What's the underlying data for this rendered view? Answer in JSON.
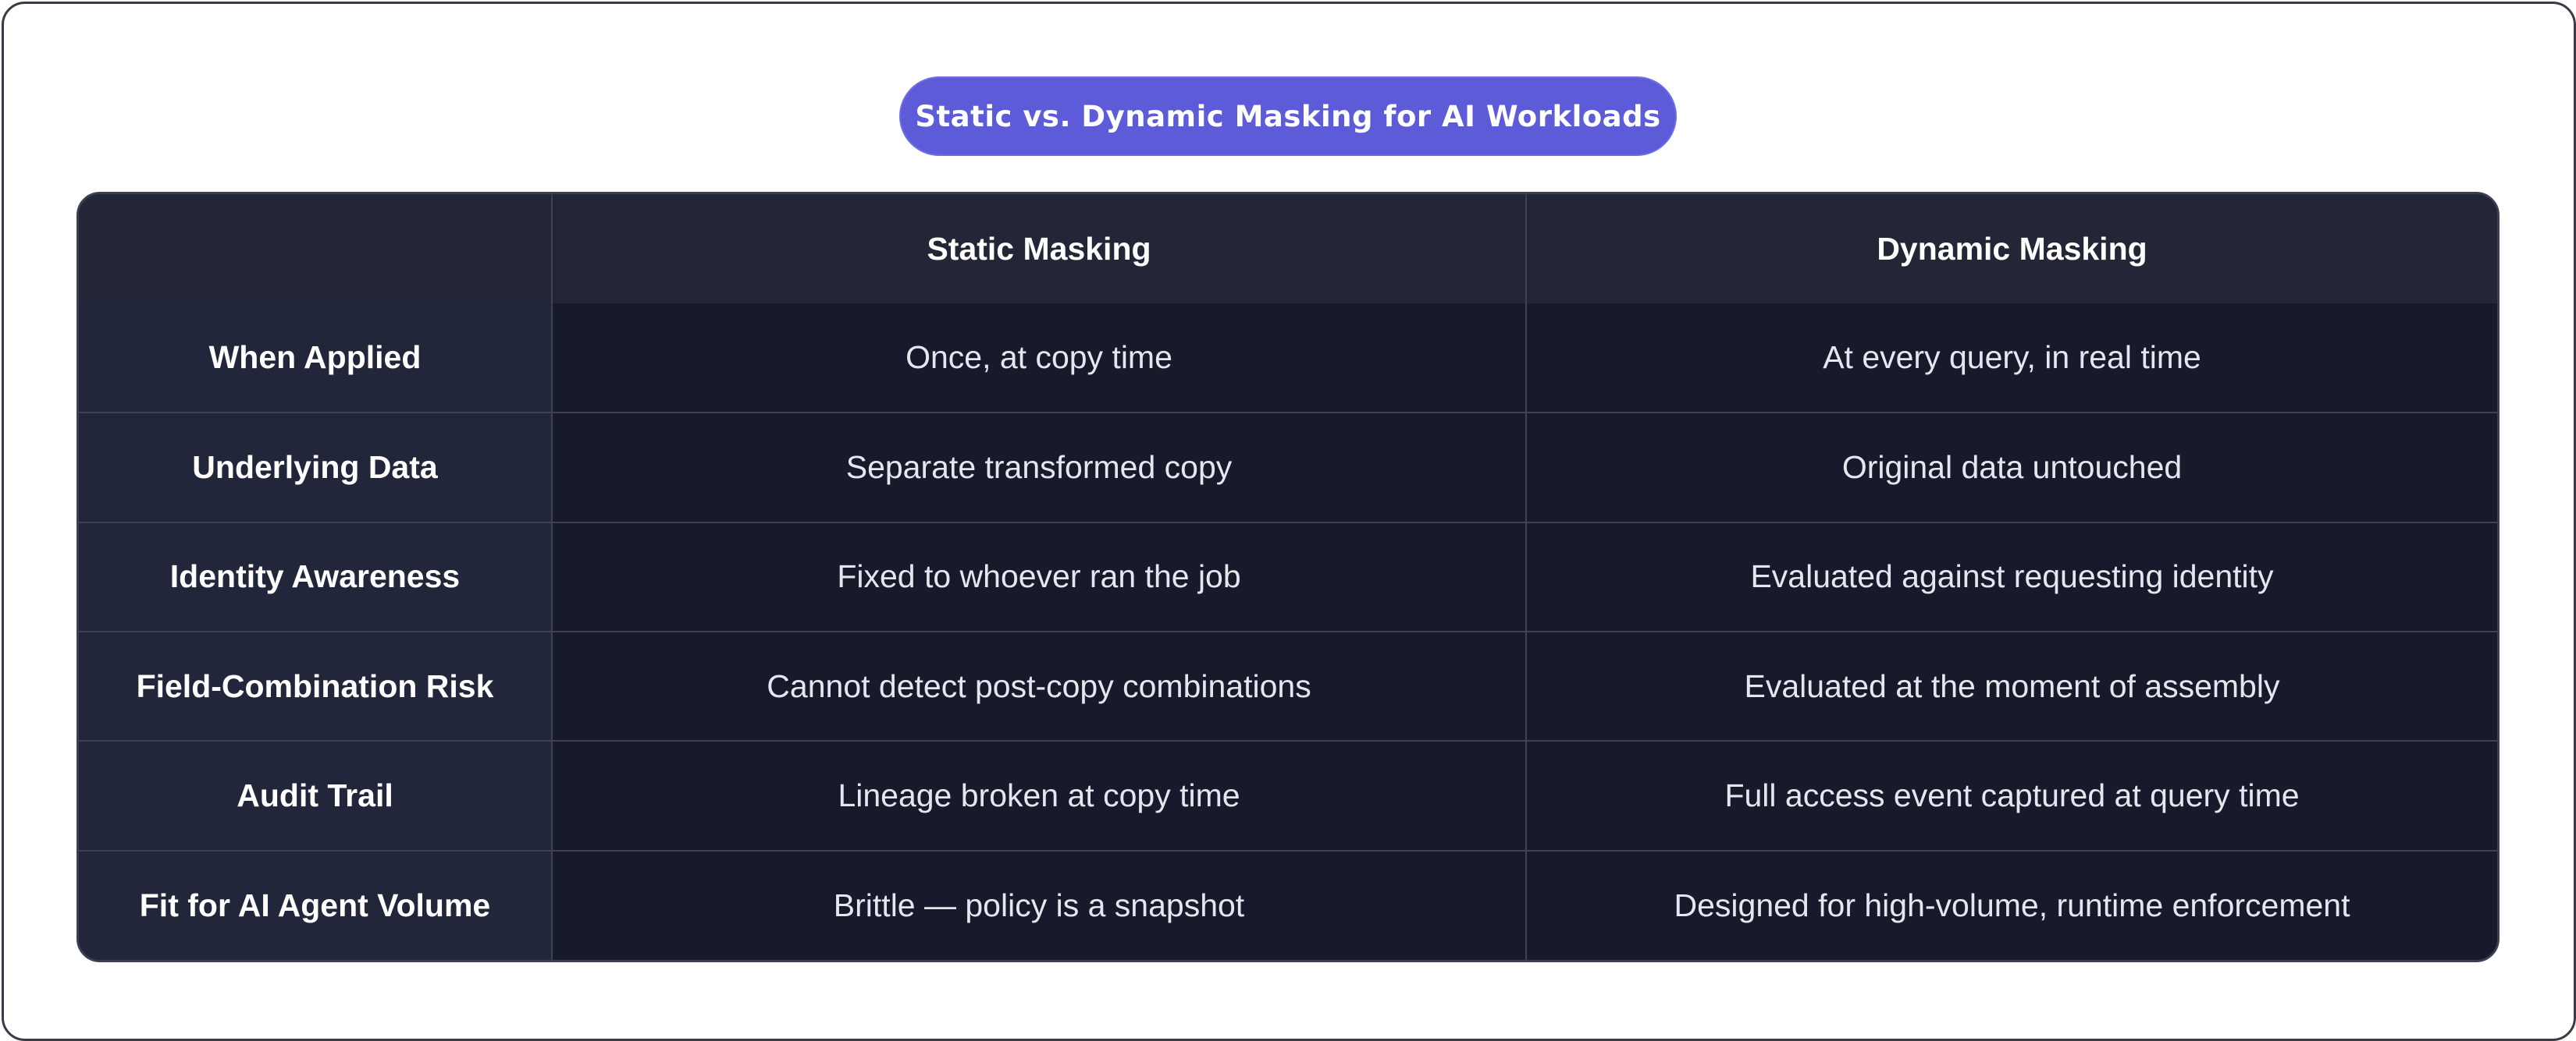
{
  "title": "Static vs. Dynamic Masking for AI Workloads",
  "table": {
    "corner_header": "",
    "columns": [
      "Static Masking",
      "Dynamic Masking"
    ],
    "rows": [
      {
        "label": "When Applied",
        "static": "Once, at copy time",
        "dynamic": "At every query, in real time"
      },
      {
        "label": "Underlying Data",
        "static": "Separate transformed copy",
        "dynamic": "Original data untouched"
      },
      {
        "label": "Identity Awareness",
        "static": "Fixed to whoever ran the job",
        "dynamic": "Evaluated against requesting identity"
      },
      {
        "label": "Field-Combination Risk",
        "static": "Cannot detect post-copy combinations",
        "dynamic": "Evaluated at the moment of assembly"
      },
      {
        "label": "Audit Trail",
        "static": "Lineage broken at copy time",
        "dynamic": "Full access event captured at query time"
      },
      {
        "label": "Fit for AI Agent Volume",
        "static": "Brittle — policy is a snapshot",
        "dynamic": "Designed for high-volume, runtime enforcement"
      }
    ]
  },
  "colors": {
    "title_pill": "#5d5bd8",
    "table_body": "#161a2b",
    "header_row": "#222636",
    "row_header": "#22263a"
  }
}
